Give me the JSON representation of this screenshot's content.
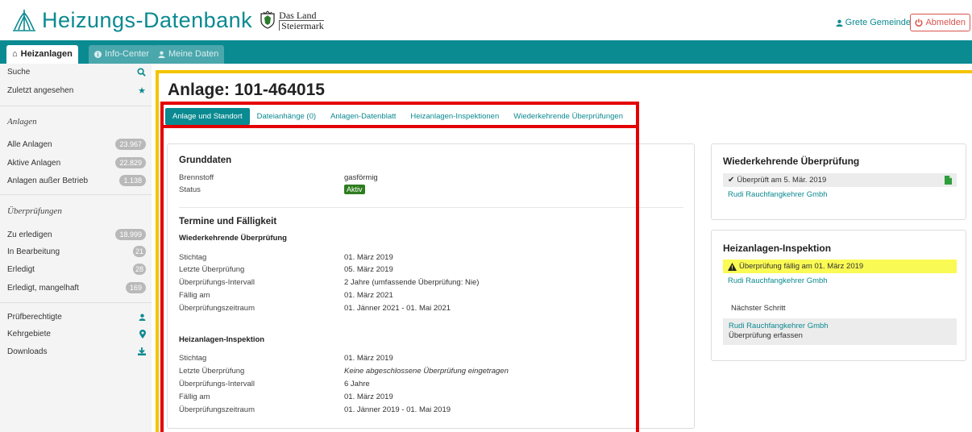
{
  "header": {
    "app_title": "Heizungs-Datenbank",
    "land_line1": "Das Land",
    "land_line2": "Steiermark",
    "user_name": "Grete Gemeinde",
    "logout_label": "Abmelden",
    "brand_color": "#0a8a91"
  },
  "nav": {
    "tabs": [
      {
        "label": "Heizanlagen",
        "icon": "home-icon",
        "active": true
      },
      {
        "label": "Info-Center",
        "icon": "info-icon",
        "active": false
      },
      {
        "label": "Meine Daten",
        "icon": "user-icon",
        "active": false
      }
    ]
  },
  "sidebar": {
    "search": "Suche",
    "recent": "Zuletzt angesehen",
    "section_anlagen": "Anlagen",
    "all": {
      "label": "Alle Anlagen",
      "count": "23.967"
    },
    "active": {
      "label": "Aktive Anlagen",
      "count": "22.829"
    },
    "inactive": {
      "label": "Anlagen außer Betrieb",
      "count": "1.138"
    },
    "section_ueberpruefungen": "Überprüfungen",
    "todo": {
      "label": "Zu erledigen",
      "count": "18.999"
    },
    "in_progress": {
      "label": "In Bearbeitung",
      "count": "21"
    },
    "done": {
      "label": "Erledigt",
      "count": "28"
    },
    "done_defect": {
      "label": "Erledigt, mangelhaft",
      "count": "169"
    },
    "inspectors": "Prüfberechtigte",
    "districts": "Kehrgebiete",
    "downloads": "Downloads"
  },
  "page": {
    "title": "Anlage: 101-464015",
    "tabs": [
      "Anlage und Standort",
      "Dateianhänge (0)",
      "Anlagen-Datenblatt",
      "Heizanlagen-Inspektionen",
      "Wiederkehrende Überprüfungen"
    ]
  },
  "main": {
    "grunddaten_title": "Grunddaten",
    "fuel_label": "Brennstoff",
    "fuel_value": "gasförmig",
    "status_label": "Status",
    "status_value": "Aktiv",
    "termine_title": "Termine und Fälligkeit",
    "wu_title": "Wiederkehrende Überprüfung",
    "wu_rows": [
      {
        "k": "Stichtag",
        "v": "01. März 2019"
      },
      {
        "k": "Letzte Überprüfung",
        "v": "05. März 2019"
      },
      {
        "k": "Überprüfungs-Intervall",
        "v": "2 Jahre (umfassende Überprüfung: Nie)"
      },
      {
        "k": "Fällig am",
        "v": "01. März 2021"
      },
      {
        "k": "Überprüfungszeitraum",
        "v": "01. Jänner 2021 - 01. Mai 2021"
      }
    ],
    "hi_title": "Heizanlagen-Inspektion",
    "hi_rows": [
      {
        "k": "Stichtag",
        "v": "01. März 2019"
      },
      {
        "k": "Letzte Überprüfung",
        "v": "Keine abgeschlossene Überprüfung eingetragen"
      },
      {
        "k": "Überprüfungs-Intervall",
        "v": "6 Jahre"
      },
      {
        "k": "Fällig am",
        "v": "01. März 2019"
      },
      {
        "k": "Überprüfungszeitraum",
        "v": "01. Jänner 2019 - 01. Mai 2019"
      }
    ]
  },
  "right": {
    "wu_title": "Wiederkehrende Überprüfung",
    "wu_status": "Überprüft am 5. Mär. 2019",
    "wu_company": "Rudi Rauchfangkehrer Gmbh",
    "hi_title": "Heizanlagen-Inspektion",
    "hi_status": "Überprüfung fällig am 01. März 2019",
    "hi_company": "Rudi Rauchfangkehrer Gmbh",
    "next_label": "Nächster Schritt",
    "next_company": "Rudi Rauchfangkehrer Gmbh",
    "next_action": "Überprüfung erfassen"
  }
}
